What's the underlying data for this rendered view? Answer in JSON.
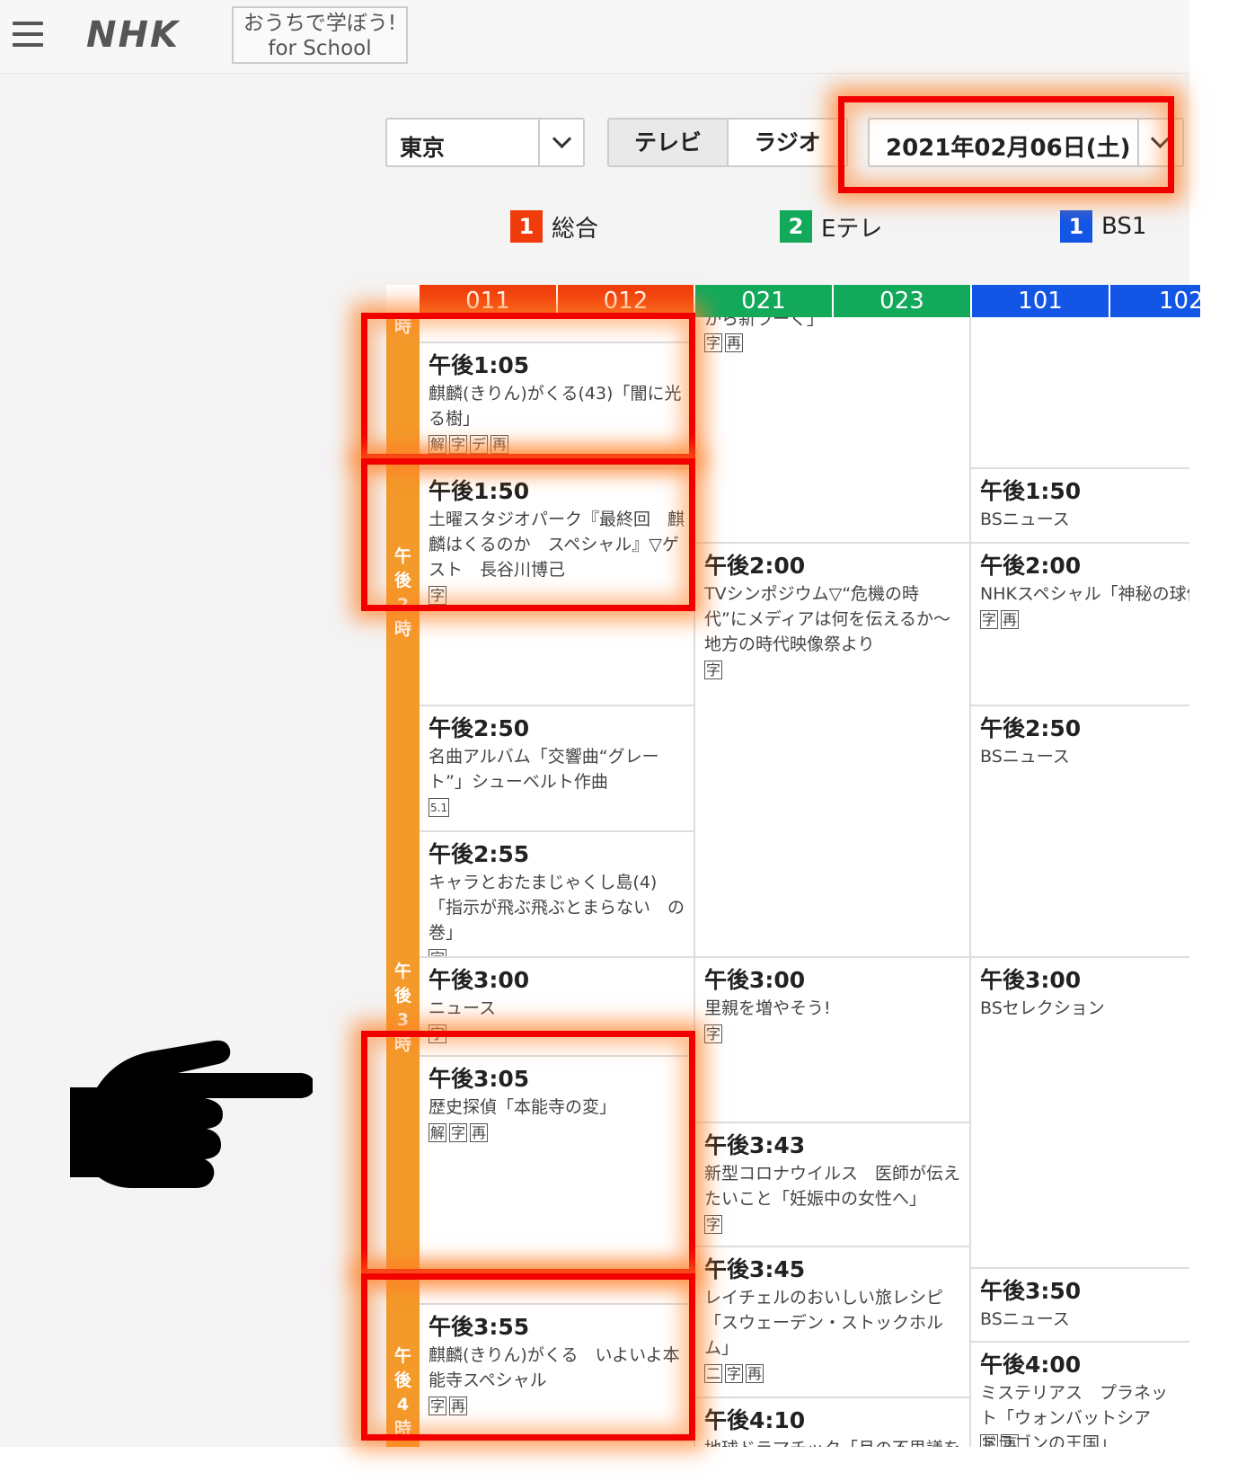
{
  "header": {
    "logo_text": "NHK",
    "school_badge_line1": "おうちで学ぼう!",
    "school_badge_line2": "for School"
  },
  "controls": {
    "area_value": "東京",
    "media_tabs": [
      "テレビ",
      "ラジオ"
    ],
    "date_value": "2021年02月06日(土)"
  },
  "channels": [
    {
      "num": "1",
      "name": "総合",
      "color": "#f03c0a"
    },
    {
      "num": "2",
      "name": "Eテレ",
      "color": "#13a95b"
    },
    {
      "num": "1",
      "name": "BS1",
      "color": "#1356e6"
    }
  ],
  "subchannels": [
    "011",
    "012",
    "021",
    "023",
    "101",
    "102"
  ],
  "hour_labels": {
    "h1": "時",
    "h2": "午後2時",
    "h3": "午後3時",
    "h4": "午後4時"
  },
  "programs": {
    "sogo": [
      {
        "time": "午後1:05",
        "title": "麒麟(きりん)がくる(43)「闇に光る樹」",
        "tags": [
          "解",
          "字",
          "デ",
          "再"
        ]
      },
      {
        "time": "午後1:50",
        "title": "土曜スタジオパーク『最終回　麒麟はくるのか　スペシャル』▽ゲスト　長谷川博己",
        "tags": [
          "字"
        ]
      },
      {
        "time": "午後2:50",
        "title": "名曲アルバム「交響曲“グレート”」シューベルト作曲",
        "tags": [
          "5.1"
        ]
      },
      {
        "time": "午後2:55",
        "title": "キャラとおたまじゃくし島(4)「指示が飛ぶ飛ぶとまらない　の巻」",
        "tags": [
          "字"
        ]
      },
      {
        "time": "午後3:00",
        "title": "ニュース",
        "tags": [
          "字"
        ]
      },
      {
        "time": "午後3:05",
        "title": "歴史探偵「本能寺の変」",
        "tags": [
          "解",
          "字",
          "再"
        ]
      },
      {
        "time": "午後3:55",
        "title": "麒麟(きりん)がくる　いよいよ本能寺スペシャル",
        "tags": [
          "字",
          "再"
        ]
      }
    ],
    "etele": [
      {
        "time": "",
        "title": "から新ラーく」",
        "tags": [
          "字",
          "再"
        ]
      },
      {
        "time": "午後2:00",
        "title": "TVシンポジウム▽“危機の時代”にメディアは何を伝えるか〜地方の時代映像祭より",
        "tags": [
          "字"
        ]
      },
      {
        "time": "午後3:00",
        "title": "里親を増やそう!",
        "tags": [
          "字"
        ]
      },
      {
        "time": "午後3:43",
        "title": "新型コロナウイルス　医師が伝えたいこと「妊娠中の女性へ」",
        "tags": [
          "字"
        ]
      },
      {
        "time": "午後3:45",
        "title": "レイチェルのおいしい旅レシピ「スウェーデン・ストックホルム」",
        "tags": [
          "二",
          "字",
          "再"
        ]
      },
      {
        "time": "午後4:10",
        "title": "地球ドラマチック「月の不思議を巡",
        "tags": []
      }
    ],
    "bs1": [
      {
        "time": "午後1:50",
        "title": "BSニュース",
        "tags": []
      },
      {
        "time": "午後2:00",
        "title": "NHKスペシャル「神秘の球体マリモ〜北海道　阿寒湖の奇跡〜",
        "tags": [
          "字",
          "再"
        ]
      },
      {
        "time": "午後2:50",
        "title": "BSニュース",
        "tags": []
      },
      {
        "time": "午後3:00",
        "title": "BSセレクション",
        "tags": []
      },
      {
        "time": "午後3:50",
        "title": "BSニュース",
        "tags": []
      },
      {
        "time": "午後4:00",
        "title": "ミステリアス　プラネット「ウォンバットシア　ドラゴンの王国」",
        "tags": [
          "字",
          "再"
        ]
      }
    ]
  },
  "colors": {
    "highlight": "#f20000",
    "glow": "#ff8228",
    "timecol": "#f39a2a"
  },
  "pointer_icon": "pointing-hand-icon"
}
